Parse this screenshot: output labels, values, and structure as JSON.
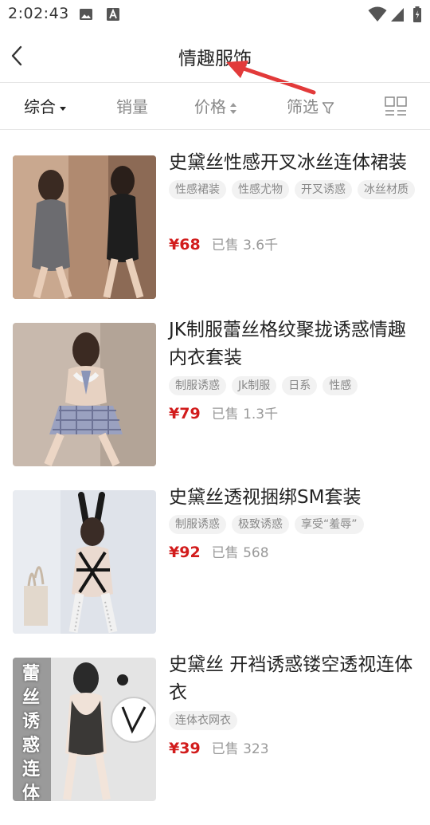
{
  "status_bar": {
    "time": "2:02:43",
    "left_icons": [
      "image-icon",
      "font-icon"
    ],
    "right_icons": [
      "wifi-icon",
      "cellular-icon",
      "battery-icon"
    ]
  },
  "header": {
    "title": "情趣服饰",
    "back_icon": "chevron-left-icon"
  },
  "filters": {
    "tabs": [
      {
        "label": "综合",
        "active": true,
        "indicator": "dropdown-caret-icon"
      },
      {
        "label": "销量",
        "active": false
      },
      {
        "label": "价格",
        "active": false,
        "indicator": "sort-updown-icon"
      },
      {
        "label": "筛选",
        "active": false,
        "indicator": "filter-icon"
      }
    ],
    "view_toggle_icon": "grid-view-icon"
  },
  "products": [
    {
      "name": "史黛丝性感开叉冰丝连体裙装",
      "tags": [
        "性感裙装",
        "性感尤物",
        "开叉诱惑",
        "冰丝材质"
      ],
      "price": "¥68",
      "sold": "已售 3.6千"
    },
    {
      "name": "JK制服蕾丝格纹聚拢诱惑情趣内衣套装",
      "tags": [
        "制服诱惑",
        "Jk制服",
        "日系",
        "性感"
      ],
      "price": "¥79",
      "sold": "已售 1.3千"
    },
    {
      "name": "史黛丝透视捆绑SM套装",
      "tags": [
        "制服诱惑",
        "极致诱惑",
        "享受“羞辱”"
      ],
      "price": "¥92",
      "sold": "已售 568"
    },
    {
      "name": "史黛丝 开裆诱惑镂空透视连体衣",
      "tags": [
        "连体衣网衣"
      ],
      "price": "¥39",
      "sold": "已售 323",
      "thumb_overlay": "蕾丝诱惑连体"
    }
  ],
  "colors": {
    "price": "#d21c1c",
    "tag_bg": "#f2f2f2",
    "annotation_arrow": "#e23a3a"
  }
}
